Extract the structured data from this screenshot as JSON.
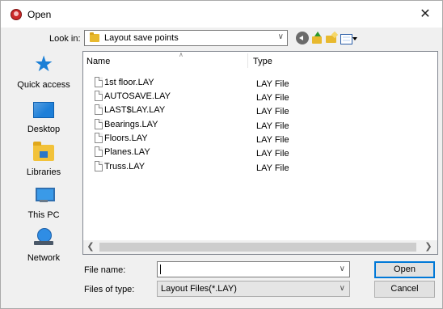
{
  "window": {
    "title": "Open",
    "close_glyph": "✕"
  },
  "toolbar": {
    "look_in_label": "Look in:",
    "look_in_value": "Layout save points",
    "icons": [
      "back-icon",
      "up-folder-icon",
      "new-folder-icon",
      "view-menu-icon"
    ]
  },
  "places": [
    {
      "label": "Quick access",
      "icon": "quick-access-star-icon"
    },
    {
      "label": "Desktop",
      "icon": "desktop-icon"
    },
    {
      "label": "Libraries",
      "icon": "libraries-icon"
    },
    {
      "label": "This PC",
      "icon": "this-pc-icon"
    },
    {
      "label": "Network",
      "icon": "network-icon"
    }
  ],
  "file_list": {
    "columns": {
      "name": "Name",
      "type": "Type"
    },
    "files": [
      {
        "name": "1st floor.LAY",
        "type": "LAY File"
      },
      {
        "name": "AUTOSAVE.LAY",
        "type": "LAY File"
      },
      {
        "name": "LAST$LAY.LAY",
        "type": "LAY File"
      },
      {
        "name": "Bearings.LAY",
        "type": "LAY File"
      },
      {
        "name": "Floors.LAY",
        "type": "LAY File"
      },
      {
        "name": "Planes.LAY",
        "type": "LAY File"
      },
      {
        "name": "Truss.LAY",
        "type": "LAY File"
      }
    ]
  },
  "form": {
    "file_name_label": "File name:",
    "file_name_value": "",
    "files_of_type_label": "Files of type:",
    "files_of_type_value": "Layout Files(*.LAY)"
  },
  "buttons": {
    "open": "Open",
    "cancel": "Cancel"
  },
  "colors": {
    "accent": "#0078d7",
    "quick_access": "#1a7fd6",
    "folder": "#e8b92e"
  }
}
